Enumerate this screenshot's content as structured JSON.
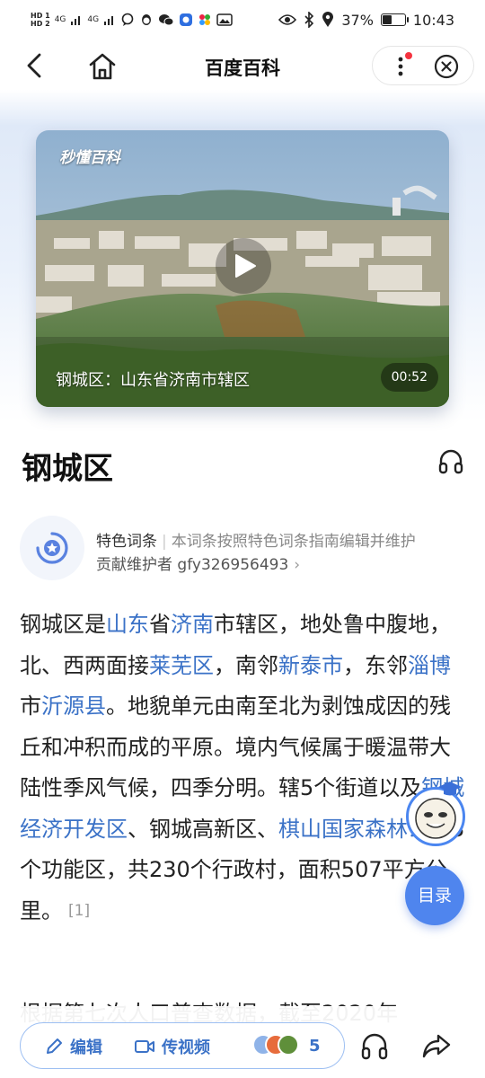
{
  "status_bar": {
    "hd1": "HD 1",
    "hd2": "HD 2",
    "sig1": "4G",
    "sig2": "4G",
    "battery": "37%",
    "time": "10:43"
  },
  "nav": {
    "title": "百度百科"
  },
  "video": {
    "logo": "秒懂百科",
    "caption": "钢城区：山东省济南市辖区",
    "duration": "00:52"
  },
  "entry": {
    "title": "钢城区"
  },
  "featured": {
    "label": "特色词条",
    "note": "本词条按照特色词条指南编辑并维护",
    "maintainer_prefix": "贡献维护者",
    "maintainer": "gfy326956493",
    "chevron": "›"
  },
  "summary": {
    "t1": "钢城区是",
    "l1": "山东",
    "t2": "省",
    "l2": "济南",
    "t3": "市辖区，地处鲁中腹地，北、西两面接",
    "l3": "莱芜区",
    "t4": "，南邻",
    "l4": "新泰市",
    "t5": "，东邻",
    "l5": "淄博",
    "t6": "市",
    "l6": "沂源县",
    "t7": "。地貌单元由南至北为剥蚀成因的残丘和冲积而成的平原。境内气候属于暖温带大陆性季风气候，四季分明。辖5个街道以及",
    "l7": "钢城经济开发区",
    "t8": "、钢城高新区、",
    "l8": "棋山国家森林公园",
    "t9": "3个功能区，共230个行政村，面积507平方公里。",
    "cite": "[1]",
    "next": "根据第七次人口普查数据，截至2020年"
  },
  "floating": {
    "toc": "目录"
  },
  "bottom": {
    "edit": "编辑",
    "upload": "传视频",
    "contributors": "5"
  }
}
